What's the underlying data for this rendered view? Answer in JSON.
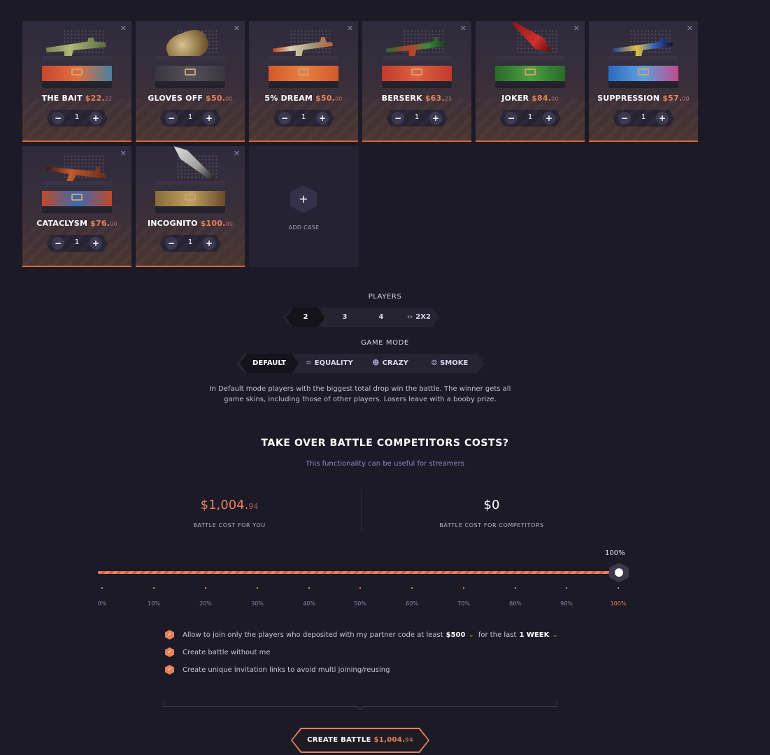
{
  "cases": [
    {
      "name": "THE BAIT",
      "price": "$22.",
      "cents": "22",
      "qty": "1",
      "band": "#c9452e",
      "gun": "#a8b070"
    },
    {
      "name": "GLOVES OFF",
      "price": "$50.",
      "cents": "00",
      "qty": "1",
      "band": "#3a3a3a",
      "gun": "#b09060"
    },
    {
      "name": "5% DREAM",
      "price": "$50.",
      "cents": "00",
      "qty": "1",
      "band": "#d2582a",
      "gun": "#c8c0a8"
    },
    {
      "name": "BERSERK",
      "price": "$63.",
      "cents": "25",
      "qty": "1",
      "band": "#c03a2a",
      "gun": "#4a8a3a"
    },
    {
      "name": "JOKER",
      "price": "$84.",
      "cents": "00",
      "qty": "1",
      "band": "#3a7a3a",
      "gun": "#b02a2a"
    },
    {
      "name": "SUPPRESSION",
      "price": "$57.",
      "cents": "00",
      "qty": "1",
      "band": "#2a6ac0",
      "gun": "#c0a040"
    },
    {
      "name": "CATACLYSM",
      "price": "$76.",
      "cents": "00",
      "qty": "1",
      "band": "#c04a2a",
      "gun": "#8a3a2a"
    },
    {
      "name": "INCOGNITO",
      "price": "$100.",
      "cents": "00",
      "qty": "1",
      "band": "#8a6a3a",
      "gun": "#d0d0d0"
    }
  ],
  "add_case": {
    "label": "ADD CASE",
    "icon": "plus-icon"
  },
  "players": {
    "label": "PLAYERS",
    "options": [
      "2",
      "3",
      "4",
      "2X2"
    ],
    "selected": "2"
  },
  "game_mode": {
    "label": "GAME MODE",
    "options": [
      {
        "label": "DEFAULT",
        "icon": ""
      },
      {
        "label": "EQUALITY",
        "icon": "equals-icon"
      },
      {
        "label": "CRAZY",
        "icon": "crazy-face-icon"
      },
      {
        "label": "SMOKE",
        "icon": "smoke-icon"
      }
    ],
    "selected": "DEFAULT",
    "description": "In Default mode players with the biggest total drop win the battle. The winner gets all game skins, including those of other players. Losers leave with a booby prize."
  },
  "takeover": {
    "title": "TAKE OVER BATTLE COMPETITORS COSTS?",
    "subtitle": "This functionality can be useful for streamers",
    "you_amount": "$1,004.",
    "you_cents": "94",
    "you_label": "BATTLE COST FOR YOU",
    "comp_amount": "$0",
    "comp_label": "BATTLE COST FOR COMPETITORS",
    "slider_value_label": "100%",
    "slider_value": 1.0,
    "ticks": [
      "0%",
      "10%",
      "20%",
      "30%",
      "40%",
      "50%",
      "60%",
      "70%",
      "80%",
      "90%",
      "100%"
    ]
  },
  "options": {
    "deposit_text_1": "Allow to join only the players who deposited with my partner code at least",
    "deposit_amount": "$500",
    "deposit_text_2": "for the last",
    "deposit_period": "1 WEEK",
    "without_me": "Create battle without me",
    "unique_links": "Create unique invitation links to avoid multi joining/reusing"
  },
  "create": {
    "label": "CREATE BATTLE",
    "price": "$1,004.",
    "cents": "94"
  },
  "colors": {
    "accent": "#e7825a",
    "background": "#1c1a26",
    "panel": "#262332"
  }
}
